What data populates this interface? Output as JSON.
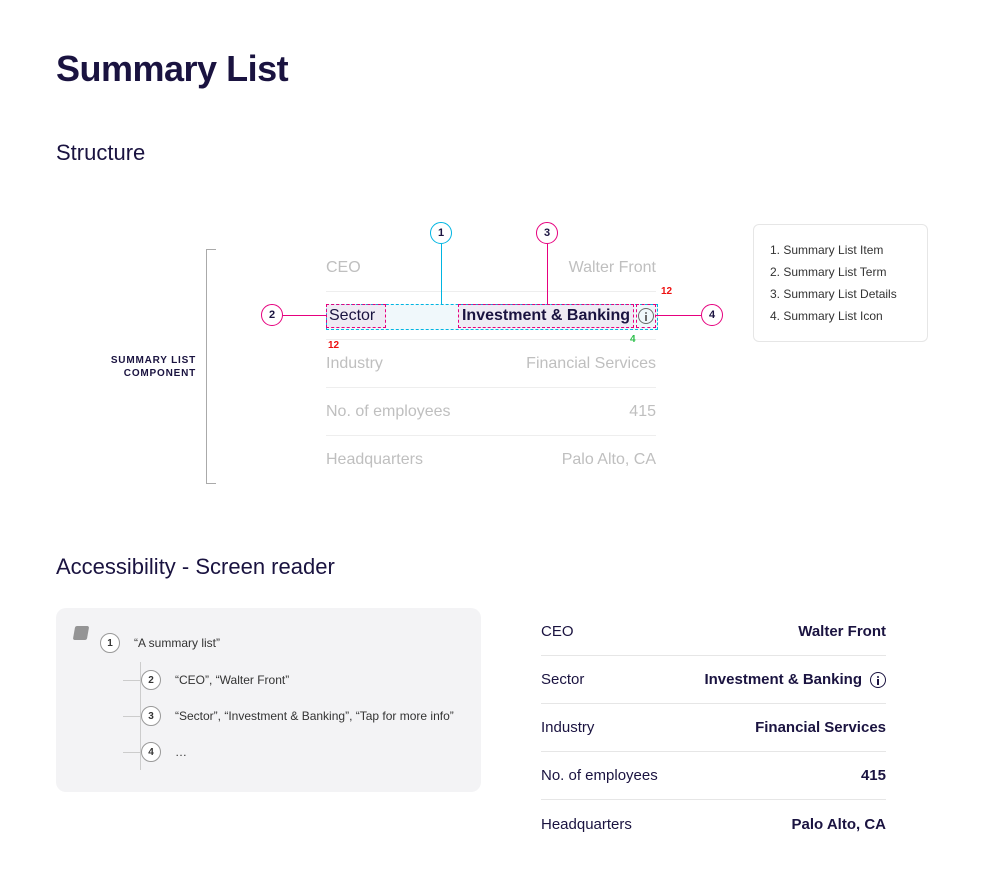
{
  "title": "Summary List",
  "structure": {
    "heading": "Structure",
    "bracket_label": "SUMMARY LIST COMPONENT",
    "rows": [
      {
        "term": "CEO",
        "detail": "Walter Front"
      },
      {
        "term": "Sector",
        "detail": "Investment & Banking"
      },
      {
        "term": "Industry",
        "detail": "Financial Services"
      },
      {
        "term": "No. of employees",
        "detail": "415"
      },
      {
        "term": "Headquarters",
        "detail": "Palo Alto, CA"
      }
    ],
    "highlight_index": 1,
    "measurements": {
      "top": "12",
      "bottom": "12",
      "icon_gap": "4"
    },
    "callouts": {
      "1": "1",
      "2": "2",
      "3": "3",
      "4": "4"
    },
    "legend": [
      "1. Summary List Item",
      "2. Summary List Term",
      "3. Summary List Details",
      "4. Summary List Icon"
    ]
  },
  "a11y": {
    "heading": "Accessibility - Screen reader",
    "tree": {
      "root": "“A summary list”",
      "children": [
        "“CEO”, “Walter Front”",
        "“Sector”, “Investment & Banking”, “Tap for more info”",
        "…"
      ],
      "nums": {
        "root": "1",
        "c1": "2",
        "c2": "3",
        "c3": "4"
      }
    },
    "component_rows": [
      {
        "term": "CEO",
        "detail": "Walter Front",
        "icon": false
      },
      {
        "term": "Sector",
        "detail": "Investment & Banking",
        "icon": true
      },
      {
        "term": "Industry",
        "detail": "Financial Services",
        "icon": false
      },
      {
        "term": "No. of employees",
        "detail": "415",
        "icon": false
      },
      {
        "term": "Headquarters",
        "detail": "Palo Alto, CA",
        "icon": false
      }
    ]
  }
}
